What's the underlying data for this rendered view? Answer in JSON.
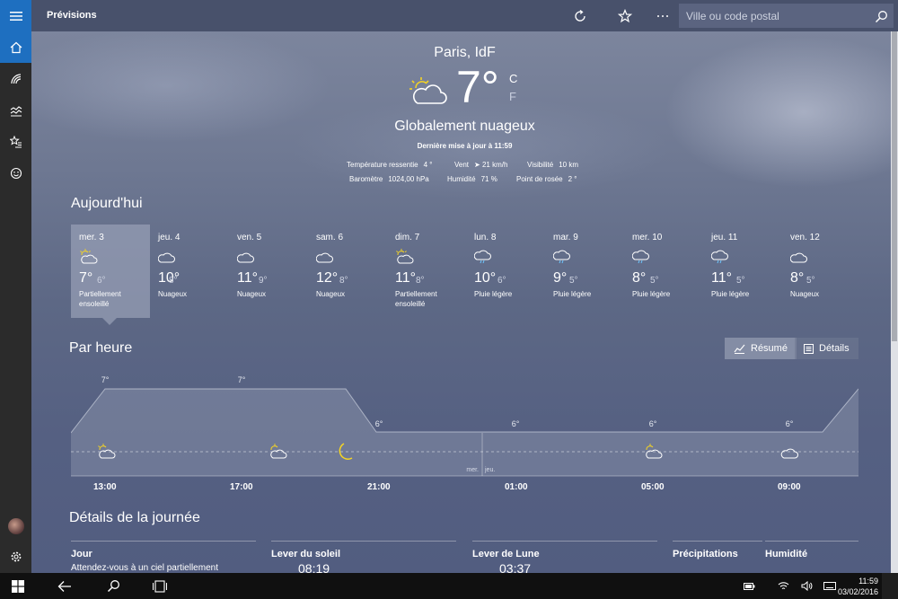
{
  "app": {
    "title": "Prévisions",
    "search_placeholder": "Ville ou code postal"
  },
  "current": {
    "location": "Paris, IdF",
    "temp": "7°",
    "unit_c": "C",
    "unit_f": "F",
    "condition": "Globalement nuageux",
    "last_update": "Dernière mise à jour à 11:59",
    "stats": {
      "feels_label": "Température ressentie",
      "feels_value": "4 °",
      "wind_label": "Vent",
      "wind_value": "➤ 21 km/h",
      "visibility_label": "Visibilité",
      "visibility_value": "10 km",
      "pressure_label": "Baromètre",
      "pressure_value": "1024,00 hPa",
      "humidity_label": "Humidité",
      "humidity_value": "71 %",
      "dew_label": "Point de rosée",
      "dew_value": "2 °"
    }
  },
  "daily": {
    "title": "Aujourd'hui",
    "days": [
      {
        "name": "mer. 3",
        "hi": "7°",
        "lo": "6°",
        "cond": "Partiellement ensoleillé",
        "icon": "partly-sunny-icon"
      },
      {
        "name": "jeu. 4",
        "hi": "10°",
        "lo": "8°",
        "cond": "Nuageux",
        "icon": "cloud-icon"
      },
      {
        "name": "ven. 5",
        "hi": "11°",
        "lo": "9°",
        "cond": "Nuageux",
        "icon": "cloud-icon"
      },
      {
        "name": "sam. 6",
        "hi": "12°",
        "lo": "8°",
        "cond": "Nuageux",
        "icon": "cloud-icon"
      },
      {
        "name": "dim. 7",
        "hi": "11°",
        "lo": "8°",
        "cond": "Partiellement ensoleillé",
        "icon": "partly-sunny-icon"
      },
      {
        "name": "lun. 8",
        "hi": "10°",
        "lo": "6°",
        "cond": "Pluie légère",
        "icon": "rain-cloud-icon"
      },
      {
        "name": "mar. 9",
        "hi": "9°",
        "lo": "5°",
        "cond": "Pluie légère",
        "icon": "rain-cloud-icon"
      },
      {
        "name": "mer. 10",
        "hi": "8°",
        "lo": "5°",
        "cond": "Pluie légère",
        "icon": "rain-cloud-icon"
      },
      {
        "name": "jeu. 11",
        "hi": "11°",
        "lo": "5°",
        "cond": "Pluie légère",
        "icon": "rain-cloud-icon"
      },
      {
        "name": "ven. 12",
        "hi": "8°",
        "lo": "5°",
        "cond": "Nuageux",
        "icon": "cloud-icon"
      }
    ]
  },
  "hourly": {
    "title": "Par heure",
    "summary_label": "Résumé",
    "details_label": "Détails",
    "temp_labels": [
      "7°",
      "7°",
      "6°",
      "6°",
      "6°",
      "6°"
    ],
    "hours": [
      "13:00",
      "17:00",
      "21:00",
      "01:00",
      "05:00",
      "09:00"
    ],
    "day_divider": {
      "left": "mer.",
      "right": "jeu."
    }
  },
  "details": {
    "title": "Détails de la journée",
    "columns": {
      "day_label": "Jour",
      "day_text": "Attendez-vous à un ciel partiellement",
      "sunrise_label": "Lever du soleil",
      "sunrise_value": "08:19",
      "moonrise_label": "Lever de Lune",
      "moonrise_value": "03:37",
      "precip_label": "Précipitations",
      "humidity_label": "Humidité"
    }
  },
  "taskbar": {
    "time": "11:59",
    "date": "03/02/2016"
  },
  "colors": {
    "accent": "#1e6fc0",
    "rail": "#2b2b2b",
    "topbar": "#48516b"
  }
}
